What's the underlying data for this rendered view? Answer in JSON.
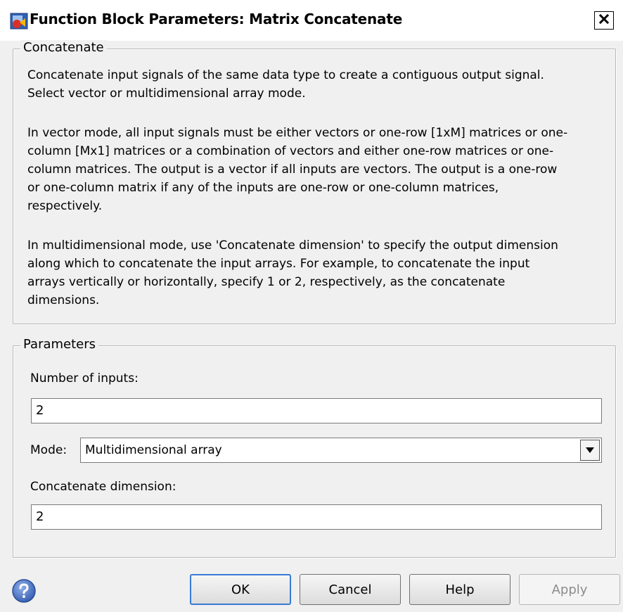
{
  "window": {
    "title": "Function Block Parameters: Matrix Concatenate",
    "close_glyph": "✕"
  },
  "concatenate": {
    "legend": "Concatenate",
    "para1_lines": [
      "Concatenate input signals of the same data type to create a contiguous output signal.",
      "Select vector or multidimensional array mode."
    ],
    "para2_lines": [
      "In vector mode, all input signals must be either vectors or one-row [1xM] matrices or one-",
      "column [Mx1] matrices or a combination of vectors and either one-row matrices or one-",
      "column matrices. The output is a vector if all inputs are vectors. The output is a one-row",
      "or one-column matrix if any of the inputs are one-row or one-column matrices,",
      "respectively."
    ],
    "para3_lines": [
      "In multidimensional mode, use 'Concatenate dimension' to specify the output dimension",
      "along which to concatenate the input arrays. For example, to concatenate the input",
      "arrays vertically or horizontally, specify 1 or 2, respectively, as the concatenate",
      "dimensions."
    ]
  },
  "parameters": {
    "legend": "Parameters",
    "num_inputs_label": "Number of inputs:",
    "num_inputs_value": "2",
    "mode_label": "Mode:",
    "mode_value": "Multidimensional array",
    "concat_dim_label": "Concatenate dimension:",
    "concat_dim_value": "2"
  },
  "buttons": {
    "ok": "OK",
    "cancel": "Cancel",
    "help": "Help",
    "apply": "Apply"
  },
  "colors": {
    "dialog_bg": "#f0f0f0",
    "default_button_border": "#3a7bd5",
    "help_icon": "#3a62b4"
  },
  "icons": {
    "title": "simulink-block-icon",
    "close": "close-icon",
    "dropdown": "chevron-down-icon",
    "help": "help-icon"
  }
}
